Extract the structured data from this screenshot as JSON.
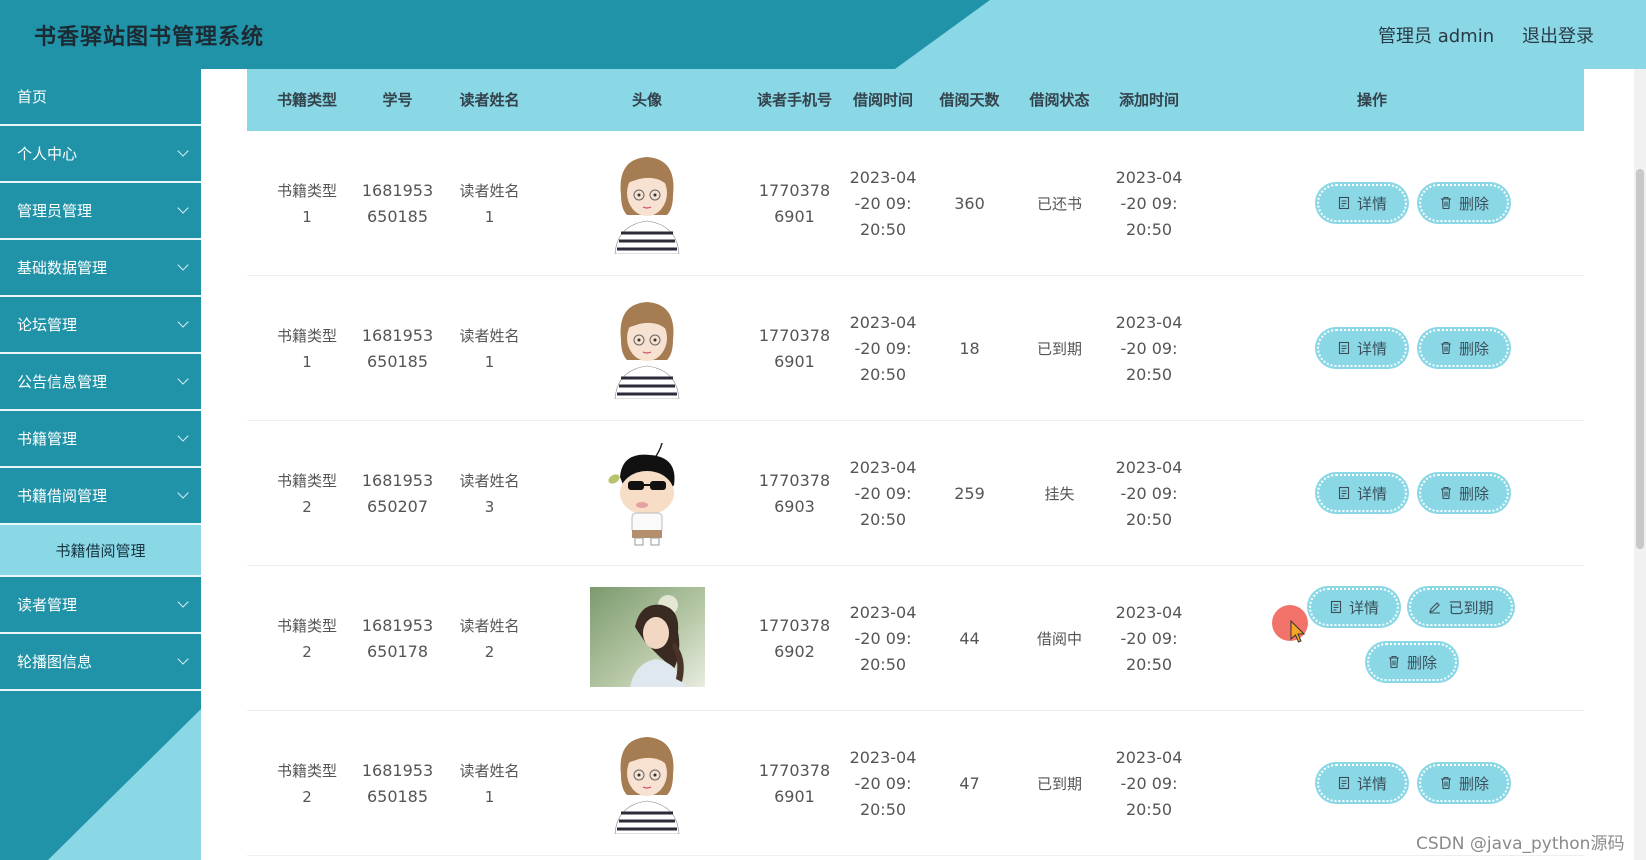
{
  "header": {
    "title": "书香驿站图书管理系统",
    "user": "管理员 admin",
    "logout": "退出登录"
  },
  "sidebar": {
    "items": [
      {
        "label": "首页",
        "chevron": false
      },
      {
        "label": "个人中心",
        "chevron": true
      },
      {
        "label": "管理员管理",
        "chevron": true
      },
      {
        "label": "基础数据管理",
        "chevron": true
      },
      {
        "label": "论坛管理",
        "chevron": true
      },
      {
        "label": "公告信息管理",
        "chevron": true
      },
      {
        "label": "书籍管理",
        "chevron": true
      },
      {
        "label": "书籍借阅管理",
        "chevron": true
      }
    ],
    "active_sub": "书籍借阅管理",
    "items_after": [
      {
        "label": "读者管理",
        "chevron": true
      },
      {
        "label": "轮播图信息",
        "chevron": true
      }
    ]
  },
  "table": {
    "columns": [
      "书籍类型",
      "学号",
      "读者姓名",
      "头像",
      "读者手机号",
      "借阅时间",
      "借阅天数",
      "借阅状态",
      "添加时间",
      "操作"
    ],
    "rows": [
      {
        "type": "书籍类型1",
        "student_id": "1681953650185",
        "reader": "读者姓名1",
        "avatar": "girl-cartoon",
        "phone": "17703786901",
        "borrow_time": "2023-04-20 09:20:50",
        "days": "360",
        "status": "已还书",
        "added": "2023-04-20 09:20:50",
        "actions": [
          "详情",
          "删除"
        ]
      },
      {
        "type": "书籍类型1",
        "student_id": "1681953650185",
        "reader": "读者姓名1",
        "avatar": "girl-cartoon",
        "phone": "17703786901",
        "borrow_time": "2023-04-20 09:20:50",
        "days": "18",
        "status": "已到期",
        "added": "2023-04-20 09:20:50",
        "actions": [
          "详情",
          "删除"
        ]
      },
      {
        "type": "书籍类型2",
        "student_id": "1681953650207",
        "reader": "读者姓名3",
        "avatar": "boy-cartoon",
        "phone": "17703786903",
        "borrow_time": "2023-04-20 09:20:50",
        "days": "259",
        "status": "挂失",
        "added": "2023-04-20 09:20:50",
        "actions": [
          "详情",
          "删除"
        ]
      },
      {
        "type": "书籍类型2",
        "student_id": "1681953650178",
        "reader": "读者姓名2",
        "avatar": "girl-photo",
        "phone": "17703786902",
        "borrow_time": "2023-04-20 09:20:50",
        "days": "44",
        "status": "借阅中",
        "added": "2023-04-20 09:20:50",
        "actions": [
          "详情",
          "已到期",
          "删除"
        ]
      },
      {
        "type": "书籍类型2",
        "student_id": "1681953650185",
        "reader": "读者姓名1",
        "avatar": "girl-cartoon",
        "phone": "17703786901",
        "borrow_time": "2023-04-20 09:20:50",
        "days": "47",
        "status": "已到期",
        "added": "2023-04-20 09:20:50",
        "actions": [
          "详情",
          "删除"
        ]
      }
    ]
  },
  "watermark": "CSDN @java_python源码",
  "colors": {
    "header_dark": "#2193a8",
    "header_light": "#8ad7e6",
    "button": "#8ad7e6"
  }
}
